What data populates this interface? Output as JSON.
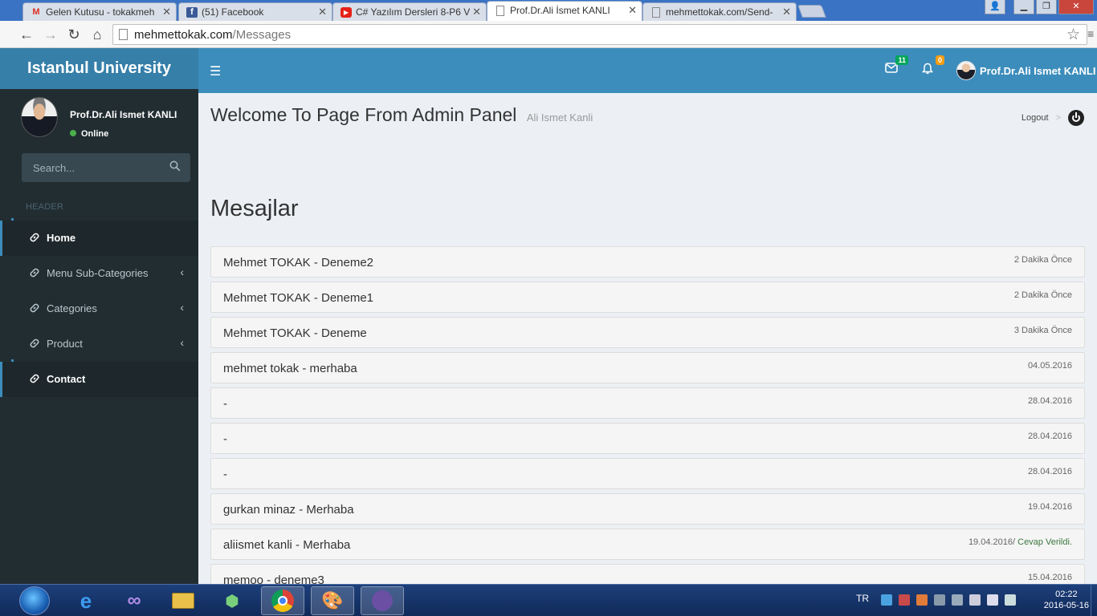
{
  "browser": {
    "tabs": [
      {
        "title": "Gelen Kutusu - tokakmeh",
        "icon": "gmail-icon",
        "active": false
      },
      {
        "title": "(51) Facebook",
        "icon": "facebook-icon",
        "active": false
      },
      {
        "title": "C# Yazılım Dersleri 8-P6 V",
        "icon": "youtube-icon",
        "active": false
      },
      {
        "title": "Prof.Dr.Ali İsmet KANLI",
        "icon": "page-icon",
        "active": true
      },
      {
        "title": "mehmettokak.com/Send-",
        "icon": "page-icon",
        "active": false
      }
    ],
    "url_host": "mehmettokak.com",
    "url_path": "/Messages"
  },
  "brand": "Istanbul University",
  "header": {
    "mail_count": "11",
    "notif_count": "0",
    "user_name": "Prof.Dr.Ali Ismet KANLI"
  },
  "sidebar": {
    "user_name": "Prof.Dr.Ali Ismet KANLI",
    "status": "Online",
    "search_placeholder": "Search...",
    "section_header": "HEADER",
    "items": [
      {
        "label": "Home",
        "active": true,
        "has_children": false
      },
      {
        "label": "Menu Sub-Categories",
        "active": false,
        "has_children": true
      },
      {
        "label": "Categories",
        "active": false,
        "has_children": true
      },
      {
        "label": "Product",
        "active": false,
        "has_children": true
      },
      {
        "label": "Contact",
        "active": true,
        "has_children": false
      }
    ]
  },
  "content": {
    "title": "Welcome To Page From Admin Panel",
    "subtitle": "Ali Ismet Kanli",
    "logout": "Logout",
    "logout_sep": ">",
    "section_title": "Mesajlar",
    "messages": [
      {
        "text": "Mehmet TOKAK - Deneme2",
        "time": "2 Dakika Önce",
        "replied": ""
      },
      {
        "text": "Mehmet TOKAK - Deneme1",
        "time": "2 Dakika Önce",
        "replied": ""
      },
      {
        "text": "Mehmet TOKAK - Deneme",
        "time": "3 Dakika Önce",
        "replied": ""
      },
      {
        "text": "mehmet tokak - merhaba",
        "time": "04.05.2016",
        "replied": ""
      },
      {
        "text": "-",
        "time": "28.04.2016",
        "replied": ""
      },
      {
        "text": "-",
        "time": "28.04.2016",
        "replied": ""
      },
      {
        "text": "-",
        "time": "28.04.2016",
        "replied": ""
      },
      {
        "text": "gurkan minaz - Merhaba",
        "time": "19.04.2016",
        "replied": ""
      },
      {
        "text": "aliismet kanli - Merhaba",
        "time": "19.04.2016/",
        "replied": " Cevap Verildi."
      },
      {
        "text": "memoo - deneme3",
        "time": "15.04.2016",
        "replied": ""
      }
    ]
  },
  "taskbar": {
    "language": "TR",
    "time": "02:22",
    "date": "2016-05-16"
  },
  "colors": {
    "header_blue": "#3c8dbc",
    "brand_blue": "#367fa9",
    "sidebar_dark": "#222d32",
    "content_bg": "#ecf0f5",
    "replied_green": "#3c763d"
  }
}
